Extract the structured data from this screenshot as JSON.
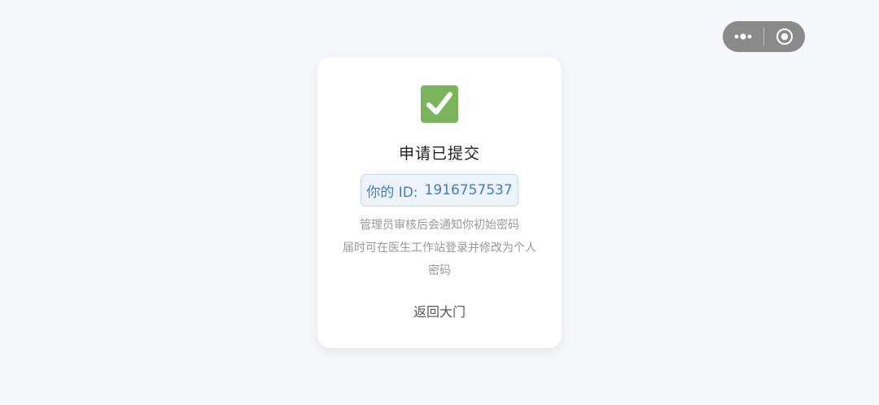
{
  "capsule": {
    "menu_icon": "more-dots-icon",
    "close_icon": "target-circle-icon"
  },
  "card": {
    "status_icon": "check-mark-icon",
    "status_color": "#7ab55c",
    "title": "申请已提交",
    "id_label": "你的 ID:",
    "id_value": "1916757537",
    "desc_line1": "管理员审核后会通知你初始密码",
    "desc_line2": "届时可在医生工作站登录并修改为个人密码",
    "back_label": "返回大门"
  }
}
